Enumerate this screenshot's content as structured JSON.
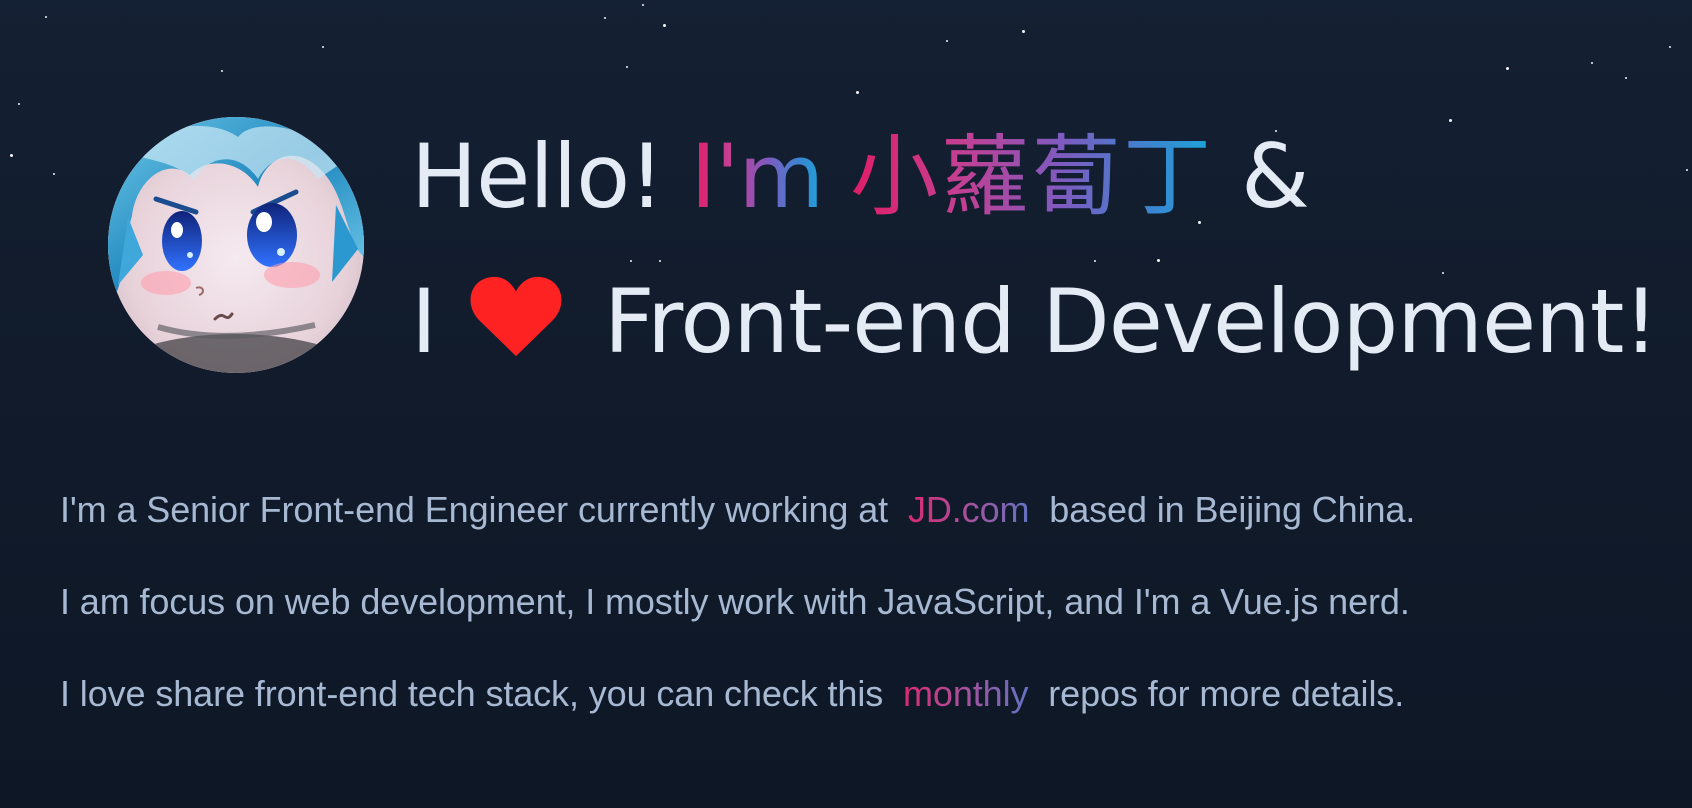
{
  "theme": {
    "background": "#111c2b",
    "text": "#e2e8f0",
    "body_text": "#a7b9d2",
    "accent_pink": "#e11d66",
    "accent_purple": "#7f5ac0",
    "accent_blue": "#1ca5d9",
    "heart": "#ff2222"
  },
  "avatar": {
    "icon": "anime-avatar-icon"
  },
  "hero": {
    "hello": "Hello!",
    "im": "I'm",
    "name": "小蘿蔔丁",
    "ampersand": "&",
    "i": "I",
    "heart_icon": "heart-icon",
    "interest": "Front-end Development!"
  },
  "about": {
    "line1_prefix": "I'm a Senior Front-end Engineer currently working at",
    "line1_link": "JD.com",
    "line1_suffix": "based in Beijing China.",
    "line2": "I am focus on web development, I mostly work with JavaScript, and I'm a Vue.js nerd.",
    "line3_prefix": "I love share front-end tech stack, you can check this",
    "line3_link": "monthly",
    "line3_suffix": "repos for more details."
  }
}
